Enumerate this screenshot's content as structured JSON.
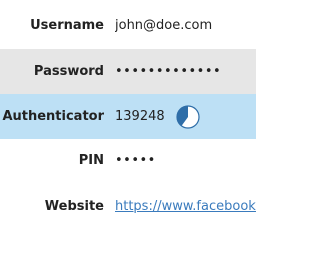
{
  "colors": {
    "selected_row": "#e6e6e6",
    "otp_row": "#bde0f5",
    "link": "#3a7bbd",
    "timer": "#2f6ea8"
  },
  "fields": {
    "username": {
      "label": "Username",
      "value": "john@doe.com"
    },
    "password": {
      "label": "Password",
      "value": "•••••••••••••"
    },
    "authenticator": {
      "label": "Authenticator",
      "value": "139248",
      "timer_icon": "countdown-pie-icon",
      "timer_remaining_fraction": 0.4
    },
    "pin": {
      "label": "PIN",
      "value": "•••••"
    },
    "website": {
      "label": "Website",
      "value": "https://www.facebook.c"
    }
  }
}
